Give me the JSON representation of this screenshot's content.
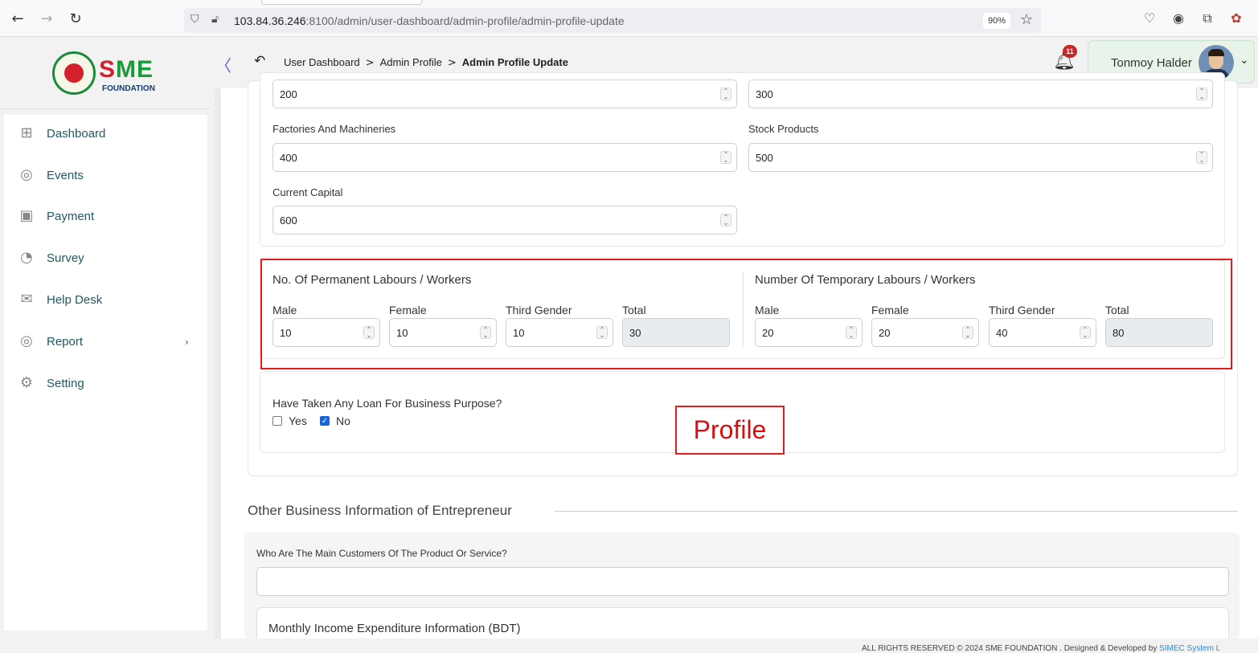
{
  "browser": {
    "url_host": "103.84.36.246",
    "url_rest": ":8100/admin/user-dashboard/admin-profile/admin-profile-update",
    "zoom": "90%"
  },
  "logo": {
    "brand_s": "S",
    "brand_me": "ME",
    "sub": "FOUNDATION"
  },
  "breadcrumb": {
    "items": [
      "User Dashboard",
      "Admin Profile",
      "Admin Profile Update"
    ],
    "separator": ">"
  },
  "header": {
    "notification_count": "11",
    "user_name": "Tonmoy Halder"
  },
  "sidebar": {
    "items": [
      {
        "label": "Dashboard",
        "icon": "grid-icon"
      },
      {
        "label": "Events",
        "icon": "events-icon"
      },
      {
        "label": "Payment",
        "icon": "payment-icon"
      },
      {
        "label": "Survey",
        "icon": "survey-icon"
      },
      {
        "label": "Help Desk",
        "icon": "mail-icon"
      },
      {
        "label": "Report",
        "icon": "report-icon",
        "has_submenu": true
      },
      {
        "label": "Setting",
        "icon": "gear-icon"
      }
    ]
  },
  "assets": {
    "top_left_value": "200",
    "top_right_value": "300",
    "factories_label": "Factories And Machineries",
    "factories_value": "400",
    "stock_label": "Stock Products",
    "stock_value": "500",
    "capital_label": "Current Capital",
    "capital_value": "600"
  },
  "labours": {
    "permanent": {
      "title": "No. Of Permanent Labours / Workers",
      "male_label": "Male",
      "male": "10",
      "female_label": "Female",
      "female": "10",
      "third_label": "Third Gender",
      "third": "10",
      "total_label": "Total",
      "total": "30"
    },
    "temporary": {
      "title": "Number Of Temporary Labours / Workers",
      "male_label": "Male",
      "male": "20",
      "female_label": "Female",
      "female": "20",
      "third_label": "Third Gender",
      "third": "40",
      "total_label": "Total",
      "total": "80"
    }
  },
  "loan": {
    "question": "Have Taken Any Loan For Business Purpose?",
    "yes_label": "Yes",
    "no_label": "No",
    "selected": "No"
  },
  "annotation": {
    "label": "Profile"
  },
  "other_info": {
    "heading": "Other Business Information of Entrepreneur",
    "customers_label": "Who Are The Main Customers Of The Product Or Service?",
    "customers_value": "",
    "monthly_title": "Monthly Income Expenditure Information (BDT)"
  },
  "footer": {
    "text": "ALL RIGHTS RESERVED © 2024 SME FOUNDATION . Designed & Developed by",
    "link": "SIMEC System L"
  },
  "colors": {
    "annotation_red": "#e21b1b",
    "sidebar_text": "#1e5a60",
    "user_chip_bg": "#e8f3ea",
    "brand_green": "#1a9a3a"
  }
}
